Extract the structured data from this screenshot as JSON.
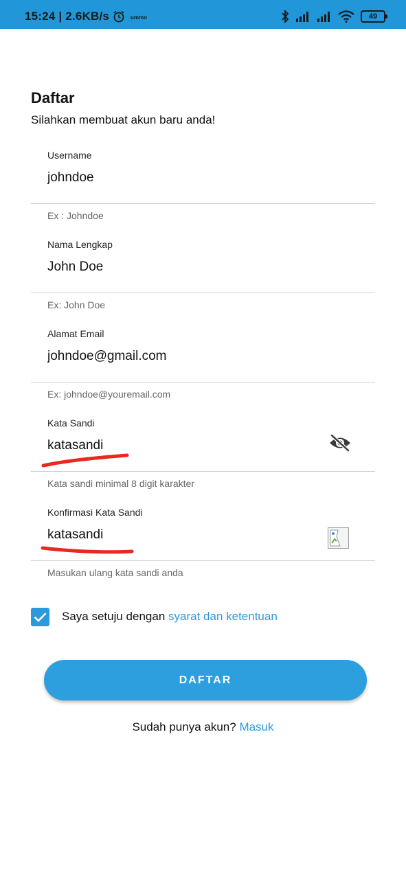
{
  "status_bar": {
    "time_speed": "15:24 | 2.6KB/s",
    "tiny_label": "ummo",
    "battery": "49",
    "icons": [
      "alarm-icon",
      "bluetooth-icon",
      "signal-icon",
      "signal-icon",
      "wifi-icon",
      "battery-icon"
    ]
  },
  "header": {
    "title": "Daftar",
    "subtitle": "Silahkan membuat akun baru anda!"
  },
  "form": {
    "username": {
      "label": "Username",
      "value": "johndoe",
      "helper": "Ex : Johndoe"
    },
    "fullname": {
      "label": "Nama Lengkap",
      "value": "John Doe",
      "helper": "Ex: John Doe"
    },
    "email": {
      "label": "Alamat Email",
      "value": "johndoe@gmail.com",
      "helper": "Ex: johndoe@youremail.com"
    },
    "password": {
      "label": "Kata Sandi",
      "value": "katasandi",
      "helper": "Kata sandi minimal 8 digit karakter",
      "icon": "eye-off-icon"
    },
    "confirm_password": {
      "label": "Konfirmasi Kata Sandi",
      "value": "katasandi",
      "helper": "Masukan ulang kata sandi anda",
      "icon": "broken-image-icon"
    }
  },
  "terms": {
    "checked": true,
    "text": "Saya setuju dengan ",
    "link": "syarat dan ketentuan"
  },
  "submit_label": "DAFTAR",
  "login_prompt": {
    "text": "Sudah punya akun? ",
    "link": "Masuk"
  },
  "colors": {
    "status_bar": "#2196d8",
    "accent": "#2b99dc",
    "button": "#2d9fdf",
    "annotation": "#e8291f"
  }
}
